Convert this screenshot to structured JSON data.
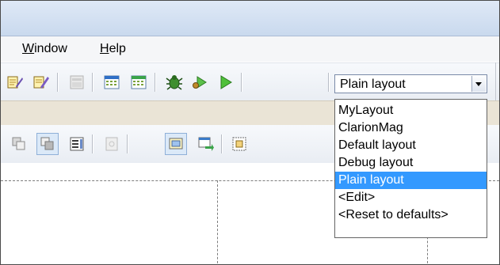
{
  "menu": {
    "window_label": "Window",
    "window_accel": "W",
    "window_rest": "indow",
    "help_label": "Help",
    "help_accel": "H",
    "help_rest": "elp"
  },
  "layout_combo": {
    "value": "Plain layout",
    "options": [
      "MyLayout",
      "ClarionMag",
      "Default layout",
      "Debug layout",
      "Plain layout",
      "<Edit>",
      "<Reset to defaults>"
    ],
    "selected_index": 4
  },
  "colors": {
    "selection": "#3399ff",
    "title_bar": "#dfe9f6",
    "band": "#eae4d6"
  },
  "icons": {
    "toolbar1": [
      "edit-ides-icon",
      "edit-icon",
      "disabled-dialog-icon",
      "calendar-icon",
      "calendar-green-icon",
      "debug-bug-icon",
      "run-debug-icon",
      "run-icon"
    ],
    "toolbar2": [
      "align-back-icon",
      "align-front-icon",
      "list-icon",
      "disabled-page-icon",
      "select-frame-icon",
      "tab-order-icon",
      "group-frame-icon"
    ]
  }
}
